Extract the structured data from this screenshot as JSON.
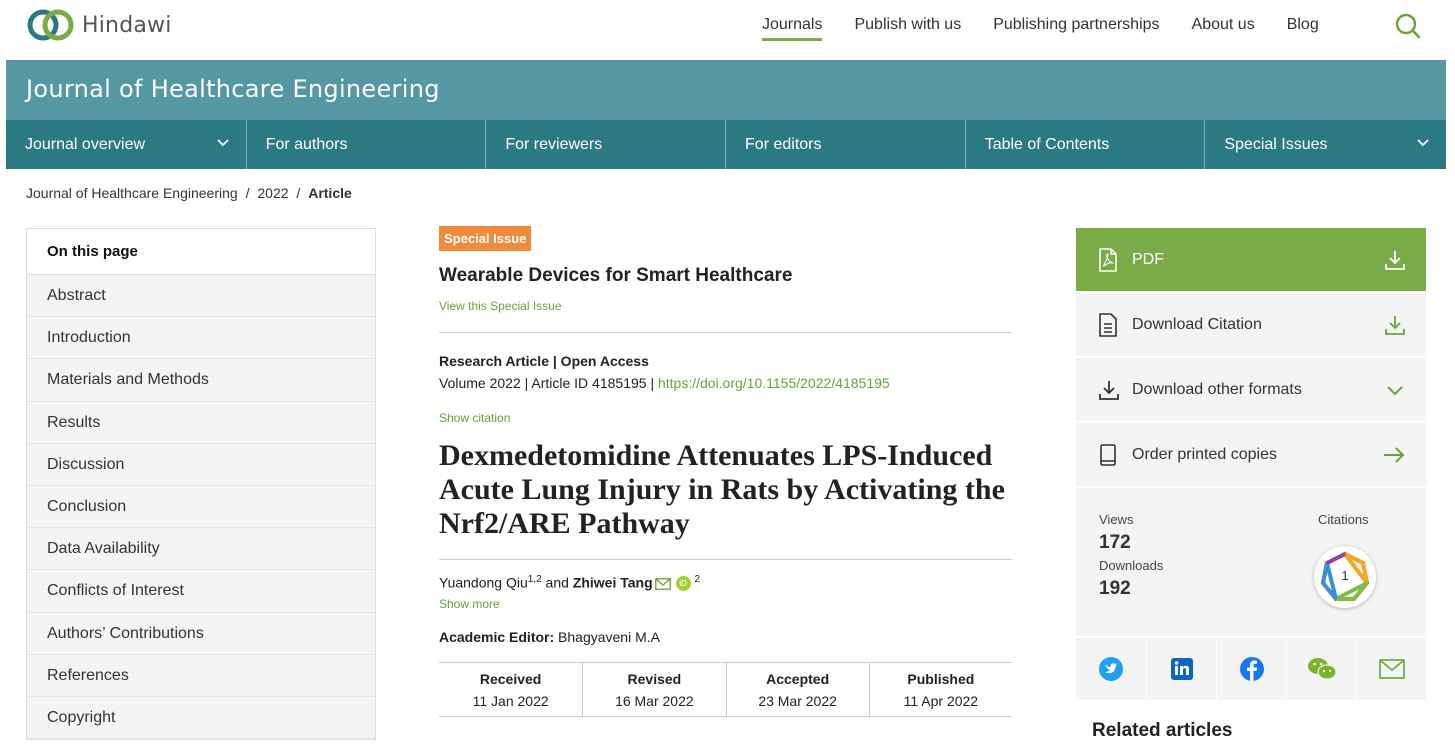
{
  "header": {
    "logo_text": "Hindawi",
    "nav": [
      "Journals",
      "Publish with us",
      "Publishing partnerships",
      "About us",
      "Blog"
    ],
    "active_nav": "Journals"
  },
  "journal": {
    "title": "Journal of Healthcare Engineering",
    "nav": [
      {
        "label": "Journal overview",
        "has_dropdown": true
      },
      {
        "label": "For authors",
        "has_dropdown": false
      },
      {
        "label": "For reviewers",
        "has_dropdown": false
      },
      {
        "label": "For editors",
        "has_dropdown": false
      },
      {
        "label": "Table of Contents",
        "has_dropdown": false
      },
      {
        "label": "Special Issues",
        "has_dropdown": true
      }
    ]
  },
  "breadcrumb": {
    "journal": "Journal of Healthcare Engineering",
    "sep1": "/",
    "year": "2022",
    "sep2": "/",
    "current": "Article"
  },
  "toc": {
    "heading": "On this page",
    "items": [
      "Abstract",
      "Introduction",
      "Materials and Methods",
      "Results",
      "Discussion",
      "Conclusion",
      "Data Availability",
      "Conflicts of Interest",
      "Authors’ Contributions",
      "References",
      "Copyright"
    ]
  },
  "article": {
    "badge": "Special Issue",
    "special_issue_title": "Wearable Devices for Smart Healthcare",
    "view_special_issue": "View this Special Issue",
    "type_line": "Research Article | Open Access",
    "volume_text": "Volume 2022 | Article ID 4185195 | ",
    "doi": "https://doi.org/10.1155/2022/4185195",
    "show_citation": "Show citation",
    "title": "Dexmedetomidine Attenuates LPS-Induced Acute Lung Injury in Rats by Activating the Nrf2/ARE Pathway",
    "author1": "Yuandong Qiu",
    "author1_sup": "1,2",
    "and": " and ",
    "author2": "Zhiwei Tang",
    "author2_sup": "2",
    "orcid": "iD",
    "show_more": "Show more",
    "editor_label": "Academic Editor:",
    "editor_name": " Bhagyaveni M.A",
    "dates": [
      {
        "label": "Received",
        "value": "11 Jan 2022"
      },
      {
        "label": "Revised",
        "value": "16 Mar 2022"
      },
      {
        "label": "Accepted",
        "value": "23 Mar 2022"
      },
      {
        "label": "Published",
        "value": "11 Apr 2022"
      }
    ]
  },
  "sidebar": {
    "pdf": "PDF",
    "download_citation": "Download Citation",
    "download_other": "Download other formats",
    "order_printed": "Order printed copies",
    "views_label": "Views",
    "views": "172",
    "downloads_label": "Downloads",
    "downloads": "192",
    "citations_label": "Citations",
    "citations": "1",
    "related_heading": "Related articles"
  },
  "colors": {
    "accent_green": "#7aab48",
    "banner_teal": "#5598a3",
    "nav_teal": "#2b7983",
    "badge_orange": "#f08a3c"
  }
}
